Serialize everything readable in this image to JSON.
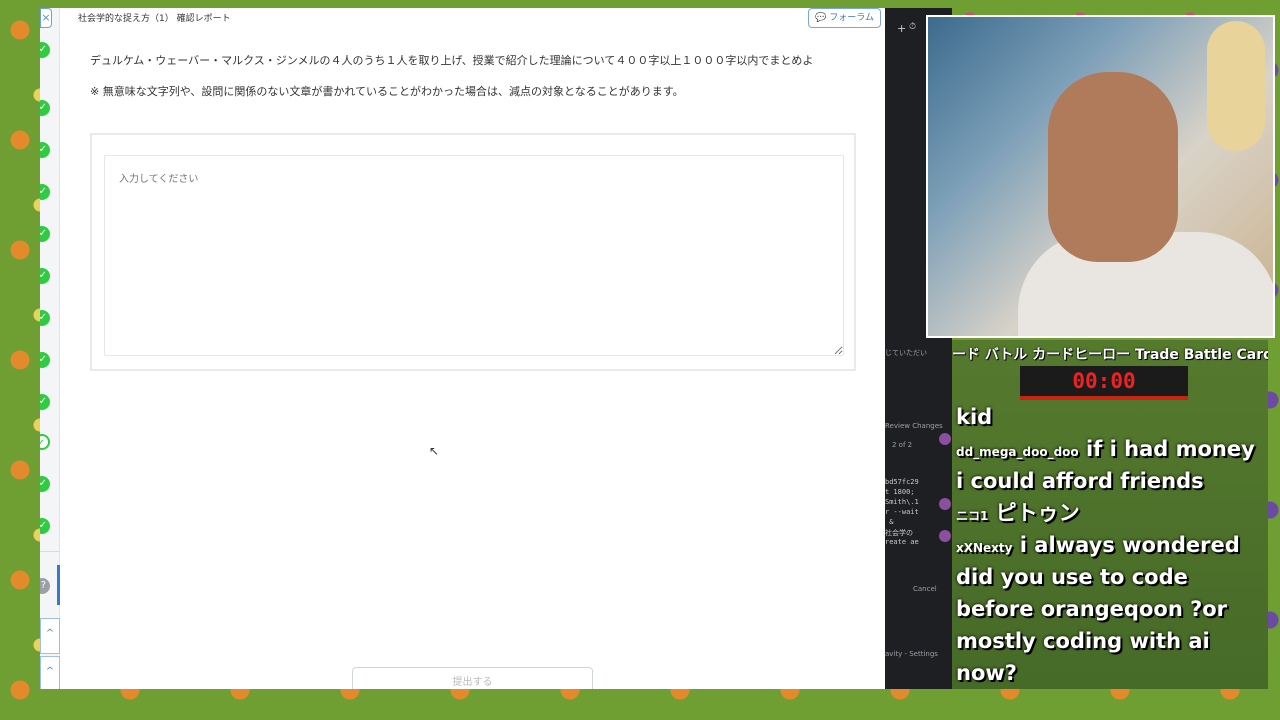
{
  "page": {
    "doc_title": "社会学的な捉え方（1） 確認レポート",
    "forum_label": "フォーラム",
    "question": "デュルケム・ウェーバー・マルクス・ジンメルの４人のうち１人を取り上げ、授業で紹介した理論について４００字以上１０００字以内でまとめよ",
    "note": "※ 無意味な文字列や、設問に関係のない文章が書かれていることがわかった場合は、減点の対象となることがあります。",
    "answer_placeholder": "入力してください",
    "submit_label": "提出する"
  },
  "ide": {
    "plus_label": "+",
    "history_label": "⏱",
    "partial_text": "じていただい",
    "review_label": "Review Changes",
    "pager": "2 of 2",
    "code_lines": [
      "bd57fc29",
      "t 1800;",
      "Smith\\.1",
      "r --wait",
      " &",
      "社会学の",
      "reate ae"
    ],
    "cancel_label": "Cancel",
    "footer_label": "avity - Settings"
  },
  "chat": {
    "ticker": "ード バトル カードヒーロー Trade Battle Card H",
    "timer": "00:00",
    "messages": [
      {
        "user": "",
        "text": "kid"
      },
      {
        "user": "dd_mega_doo_doo",
        "text": "if i had money"
      },
      {
        "user": "",
        "text": "i could afford friends"
      },
      {
        "user": "ニコ1",
        "text": "ピトゥン"
      },
      {
        "user": "xXNexty",
        "text": "i always wondered"
      },
      {
        "user": "",
        "text": "did you use to code"
      },
      {
        "user": "",
        "text": "before orangeqoon ?or"
      },
      {
        "user": "",
        "text": "mostly coding with ai"
      },
      {
        "user": "",
        "text": "now?"
      }
    ]
  },
  "icons": {
    "close": "×",
    "check": "✓",
    "help": "?",
    "chevron_up": "^"
  }
}
